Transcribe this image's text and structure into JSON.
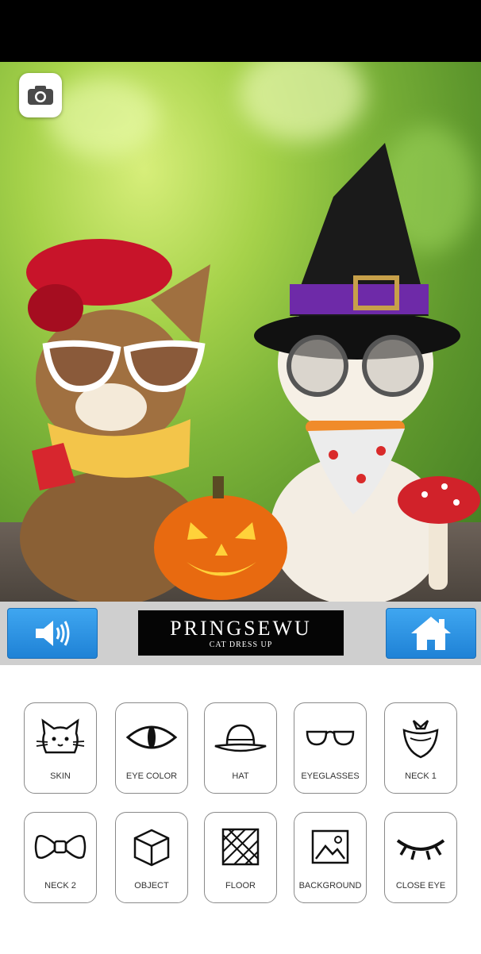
{
  "app": {
    "title_main": "PRINGSEWU",
    "title_sub": "CAT DRESS UP"
  },
  "toolbar": {
    "camera_icon": "camera-icon",
    "sound_icon": "speaker-icon",
    "home_icon": "home-icon"
  },
  "colors": {
    "button_blue": "#2a93e2",
    "banner_bg": "#050505",
    "bar_bg": "#cfcfcf"
  },
  "menu": {
    "items": [
      {
        "label": "SKIN",
        "icon": "cat-face-icon"
      },
      {
        "label": "EYE COLOR",
        "icon": "eye-icon"
      },
      {
        "label": "HAT",
        "icon": "hat-icon"
      },
      {
        "label": "EYEGLASSES",
        "icon": "eyeglasses-icon"
      },
      {
        "label": "NECK 1",
        "icon": "bandana-icon"
      },
      {
        "label": "NECK 2",
        "icon": "bowtie-icon"
      },
      {
        "label": "OBJECT",
        "icon": "cube-icon"
      },
      {
        "label": "FLOOR",
        "icon": "floor-tile-icon"
      },
      {
        "label": "BACKGROUND",
        "icon": "image-icon"
      },
      {
        "label": "CLOSE EYE",
        "icon": "closed-eye-icon"
      }
    ]
  }
}
